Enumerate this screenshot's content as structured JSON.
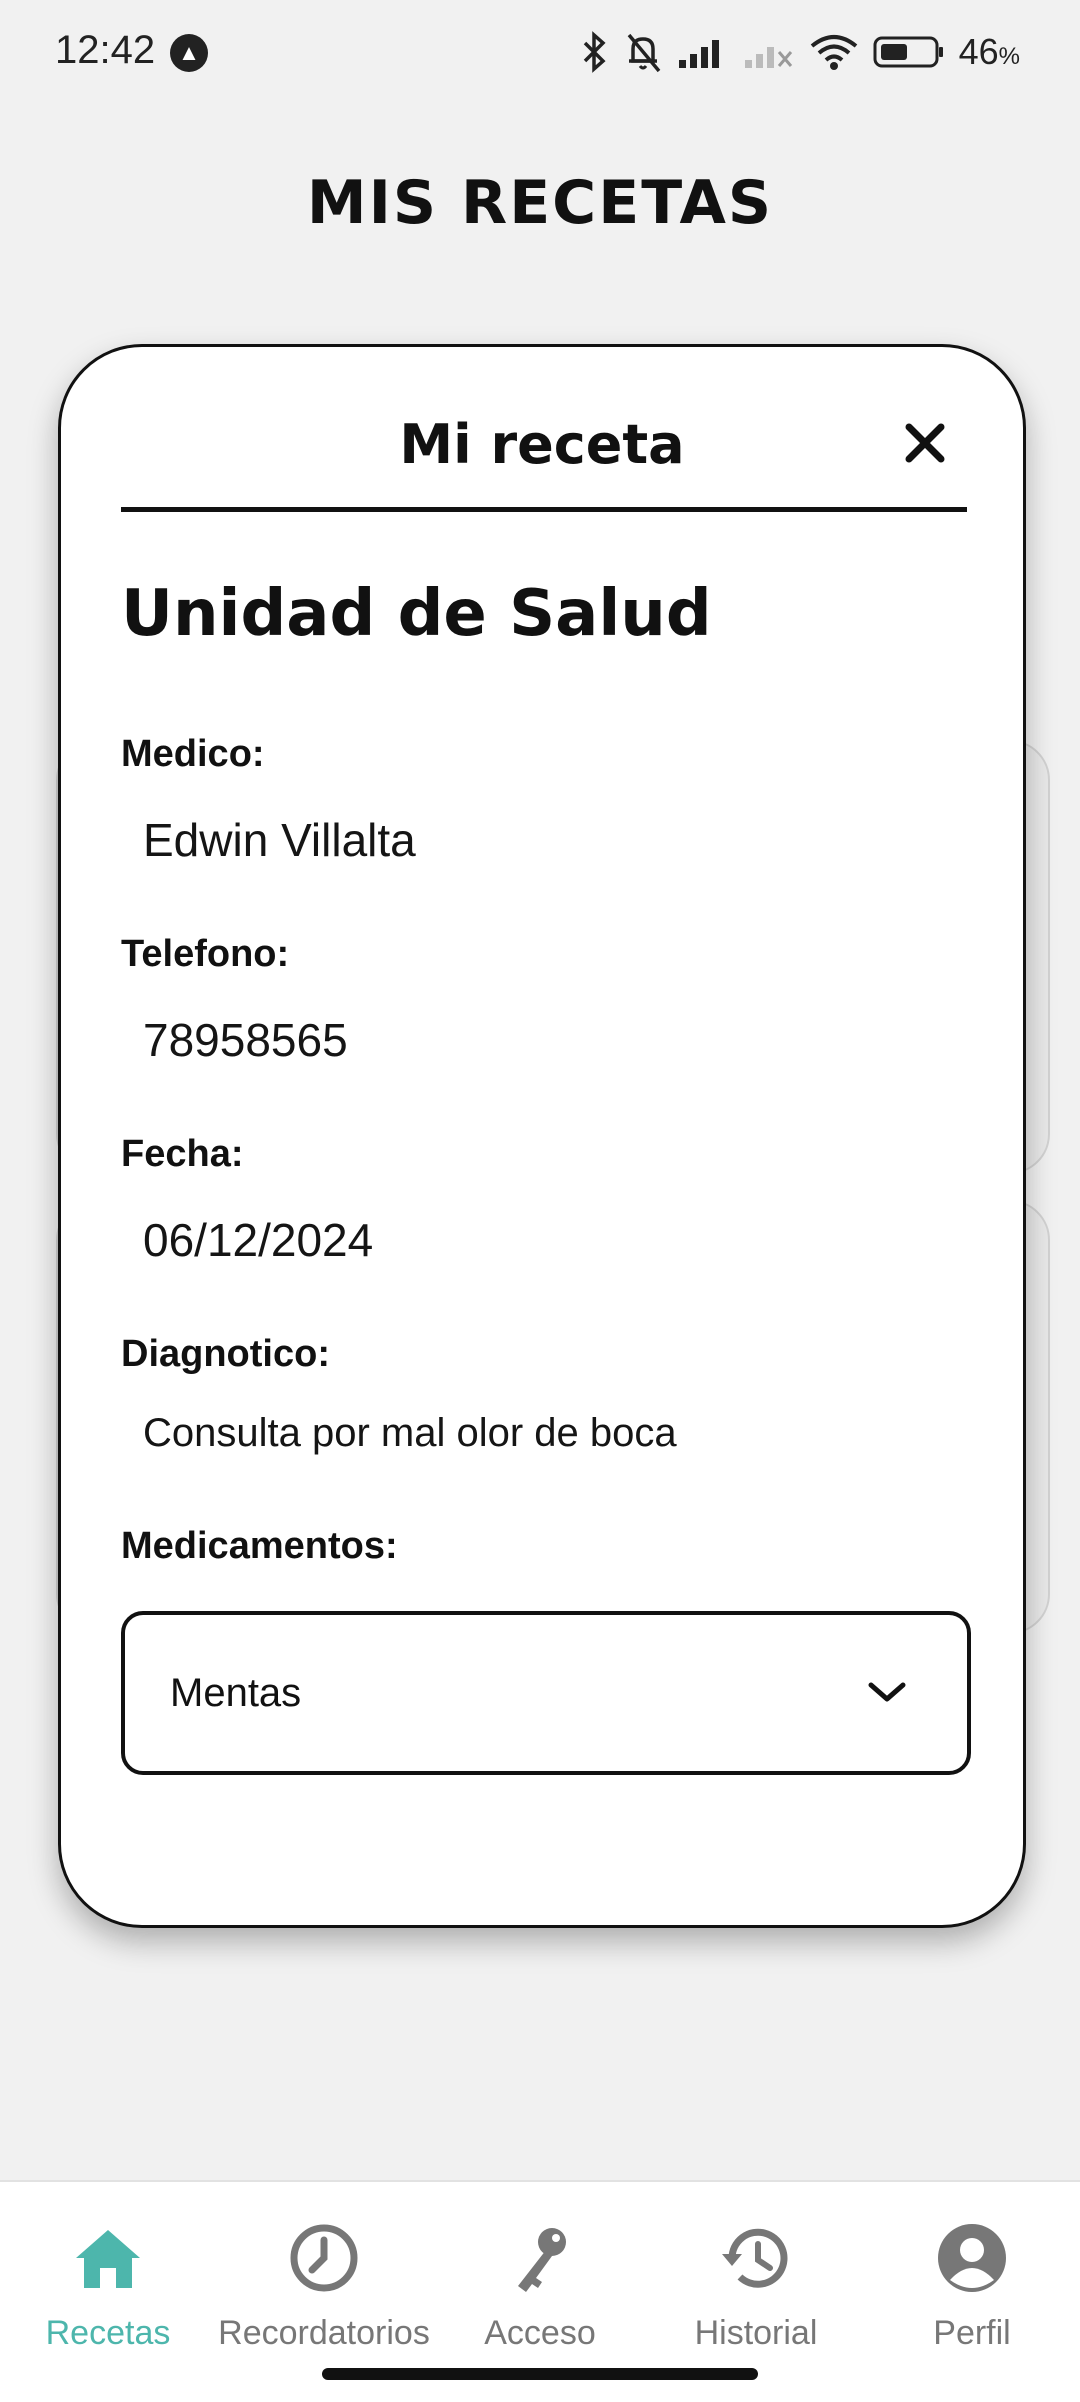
{
  "status_bar": {
    "time": "12:42",
    "battery_percent": "46",
    "battery_unit": "%"
  },
  "header": {
    "title": "MIS RECETAS"
  },
  "modal": {
    "title": "Mi receta",
    "facility": "Unidad de Salud",
    "fields": [
      {
        "label": "Medico:",
        "value": "Edwin Villalta"
      },
      {
        "label": "Telefono:",
        "value": "78958565"
      },
      {
        "label": "Fecha:",
        "value": "06/12/2024"
      },
      {
        "label": "Diagnotico:",
        "value": "Consulta por mal olor de boca"
      }
    ],
    "medications_label": "Medicamentos:",
    "medications_selected": "Mentas"
  },
  "bottom_nav": {
    "items": [
      {
        "label": "Recetas",
        "icon": "home-icon",
        "active": true
      },
      {
        "label": "Recordatorios",
        "icon": "clock-icon",
        "active": false
      },
      {
        "label": "Acceso",
        "icon": "key-icon",
        "active": false
      },
      {
        "label": "Historial",
        "icon": "history-icon",
        "active": false
      },
      {
        "label": "Perfil",
        "icon": "profile-icon",
        "active": false
      }
    ]
  },
  "colors": {
    "accent": "#4db6ac",
    "background": "#f1f1f1",
    "inactive": "#777777"
  }
}
